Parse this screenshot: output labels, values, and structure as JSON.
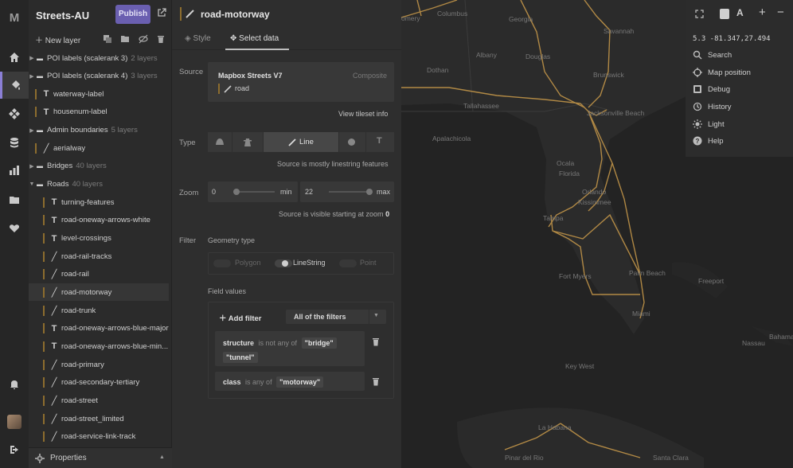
{
  "app": {
    "logo": "M",
    "style_name": "Streets-AU",
    "publish_label": "Publish"
  },
  "rail": {
    "items": [
      "home-icon",
      "paint-icon",
      "components-icon",
      "data-icon",
      "stats-icon",
      "folder-icon",
      "heart-icon",
      "bell-icon",
      "avatar",
      "logout-icon"
    ],
    "active": "paint-icon"
  },
  "layers_panel": {
    "new_layer_label": "New layer",
    "properties_label": "Properties",
    "layers": [
      {
        "name": "POI labels (scalerank 3)",
        "count": "2 layers",
        "kind": "group",
        "indent": 0
      },
      {
        "name": "POI labels (scalerank 4)",
        "count": "3 layers",
        "kind": "group",
        "indent": 0
      },
      {
        "name": "waterway-label",
        "kind": "symbol",
        "indent": 0
      },
      {
        "name": "housenum-label",
        "kind": "symbol",
        "indent": 0
      },
      {
        "name": "Admin boundaries",
        "count": "5 layers",
        "kind": "group",
        "indent": 0
      },
      {
        "name": "aerialway",
        "kind": "line",
        "indent": 0
      },
      {
        "name": "Bridges",
        "count": "40 layers",
        "kind": "group",
        "indent": 0
      },
      {
        "name": "Roads",
        "count": "40 layers",
        "kind": "group-open",
        "indent": 0
      },
      {
        "name": "turning-features",
        "kind": "symbol",
        "indent": 1
      },
      {
        "name": "road-oneway-arrows-white",
        "kind": "symbol",
        "indent": 1
      },
      {
        "name": "level-crossings",
        "kind": "symbol",
        "indent": 1
      },
      {
        "name": "road-rail-tracks",
        "kind": "line",
        "indent": 1
      },
      {
        "name": "road-rail",
        "kind": "line",
        "indent": 1
      },
      {
        "name": "road-motorway",
        "kind": "line",
        "indent": 1,
        "selected": true
      },
      {
        "name": "road-trunk",
        "kind": "line",
        "indent": 1
      },
      {
        "name": "road-oneway-arrows-blue-major",
        "kind": "symbol",
        "indent": 1
      },
      {
        "name": "road-oneway-arrows-blue-min...",
        "kind": "symbol",
        "indent": 1
      },
      {
        "name": "road-primary",
        "kind": "line",
        "indent": 1
      },
      {
        "name": "road-secondary-tertiary",
        "kind": "line",
        "indent": 1
      },
      {
        "name": "road-street",
        "kind": "line",
        "indent": 1
      },
      {
        "name": "road-street_limited",
        "kind": "line",
        "indent": 1
      },
      {
        "name": "road-service-link-track",
        "kind": "line",
        "indent": 1
      }
    ]
  },
  "editor": {
    "layer_title": "road-motorway",
    "tabs": [
      "Style",
      "Select data"
    ],
    "active_tab": "Select data",
    "source": {
      "label": "Source",
      "name": "Mapbox Streets V7",
      "badge": "Composite",
      "layer": "road",
      "tileset_link": "View tileset info"
    },
    "type": {
      "label": "Type",
      "options": [
        "fill-icon",
        "extrusion-icon",
        "Line",
        "circle-icon",
        "symbol-icon"
      ],
      "selected": "Line",
      "hint": "Source is mostly linestring features"
    },
    "zoom": {
      "label": "Zoom",
      "min_value": "0",
      "min_label": "min",
      "max_value": "22",
      "max_label": "max",
      "hint_prefix": "Source is visible starting at zoom",
      "hint_value": "0"
    },
    "filter": {
      "label": "Filter",
      "geometry_label": "Geometry type",
      "geometry_options": [
        {
          "label": "Polygon",
          "on": false
        },
        {
          "label": "LineString",
          "on": true
        },
        {
          "label": "Point",
          "on": false
        }
      ],
      "field_values_label": "Field values",
      "add_filter_label": "Add filter",
      "combinator": "All of the filters",
      "rules": [
        {
          "field": "structure",
          "op": "is not any of",
          "values": [
            "\"bridge\"",
            "\"tunnel\""
          ]
        },
        {
          "field": "class",
          "op": "is any of",
          "values": [
            "\"motorway\""
          ]
        }
      ]
    }
  },
  "map": {
    "coords": "5.3 -81.347,27.494",
    "controls": [
      "Search",
      "Map position",
      "Debug",
      "History",
      "Light",
      "Help"
    ],
    "cities": [
      "Columbus",
      "Savannah",
      "Georgia",
      "Albany",
      "Douglas",
      "Dothan",
      "Brunswick",
      "Tallahassee",
      "Jacksonville Beach",
      "Apalachicola",
      "Ocala",
      "Florida",
      "Orlando",
      "Kissimmee",
      "Tampa",
      "Fort Myers",
      "Palm Beach",
      "Miami",
      "Freeport",
      "Nassau",
      "Key West",
      "Santa Clara",
      "Pinar del Rio",
      "La Habana",
      "omery",
      "Bahama"
    ],
    "road_color": "#c99a4a"
  }
}
